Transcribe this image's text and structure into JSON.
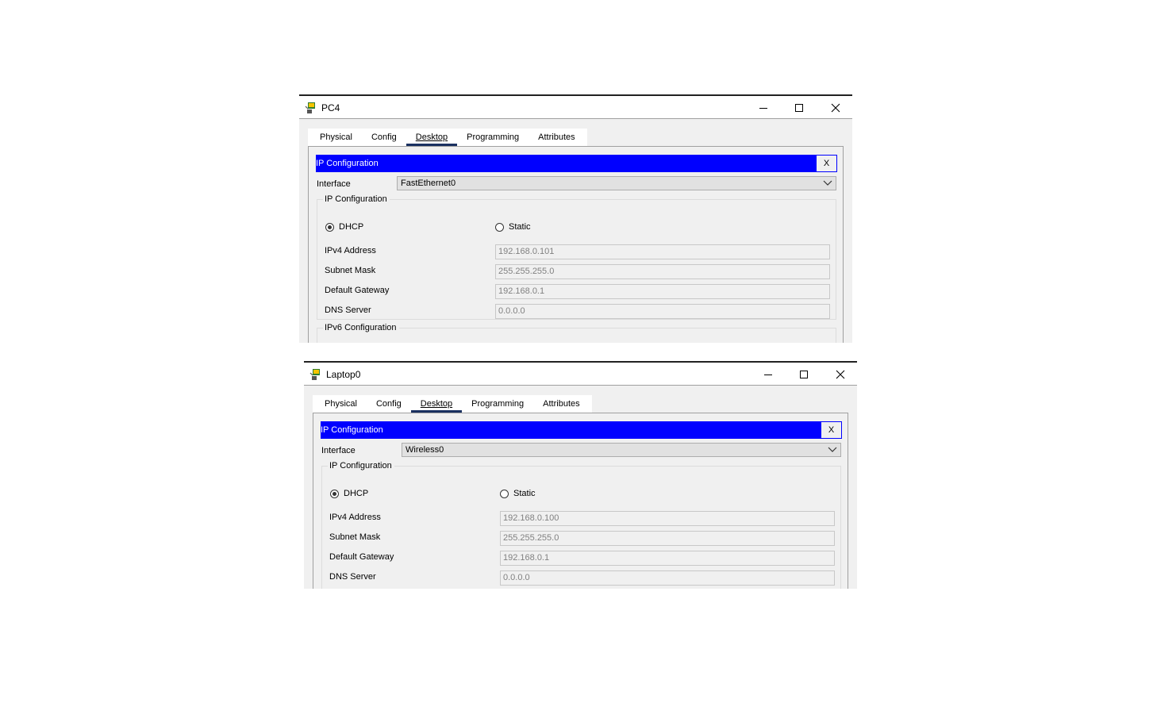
{
  "windows": [
    {
      "title": "PC4",
      "tabs": [
        "Physical",
        "Config",
        "Desktop",
        "Programming",
        "Attributes"
      ],
      "active_tab": "Desktop",
      "ip_header": "IP Configuration",
      "close_label": "X",
      "interface_label": "Interface",
      "interface_value": "FastEthernet0",
      "ipv4_group_label": "IP Configuration",
      "dhcp_label": "DHCP",
      "static_label": "Static",
      "selected_mode": "DHCP",
      "ipv4_label": "IPv4 Address",
      "ipv4_value": "192.168.0.101",
      "mask_label": "Subnet Mask",
      "mask_value": "255.255.255.0",
      "gateway_label": "Default Gateway",
      "gateway_value": "192.168.0.1",
      "dns_label": "DNS Server",
      "dns_value": "0.0.0.0",
      "ipv6_group_label": "IPv6 Configuration"
    },
    {
      "title": "Laptop0",
      "tabs": [
        "Physical",
        "Config",
        "Desktop",
        "Programming",
        "Attributes"
      ],
      "active_tab": "Desktop",
      "ip_header": "IP Configuration",
      "close_label": "X",
      "interface_label": "Interface",
      "interface_value": "Wireless0",
      "ipv4_group_label": "IP Configuration",
      "dhcp_label": "DHCP",
      "static_label": "Static",
      "selected_mode": "DHCP",
      "ipv4_label": "IPv4 Address",
      "ipv4_value": "192.168.0.100",
      "mask_label": "Subnet Mask",
      "mask_value": "255.255.255.0",
      "gateway_label": "Default Gateway",
      "gateway_value": "192.168.0.1",
      "dns_label": "DNS Server",
      "dns_value": "0.0.0.0"
    }
  ],
  "colors": {
    "header_bar": "#0000ff",
    "active_tab_underline": "#1a3060",
    "panel_bg": "#f0f0f0"
  },
  "icons": [
    "packet-tracer-pc-icon",
    "minimize-icon",
    "maximize-icon",
    "close-icon",
    "chevron-down-icon"
  ]
}
